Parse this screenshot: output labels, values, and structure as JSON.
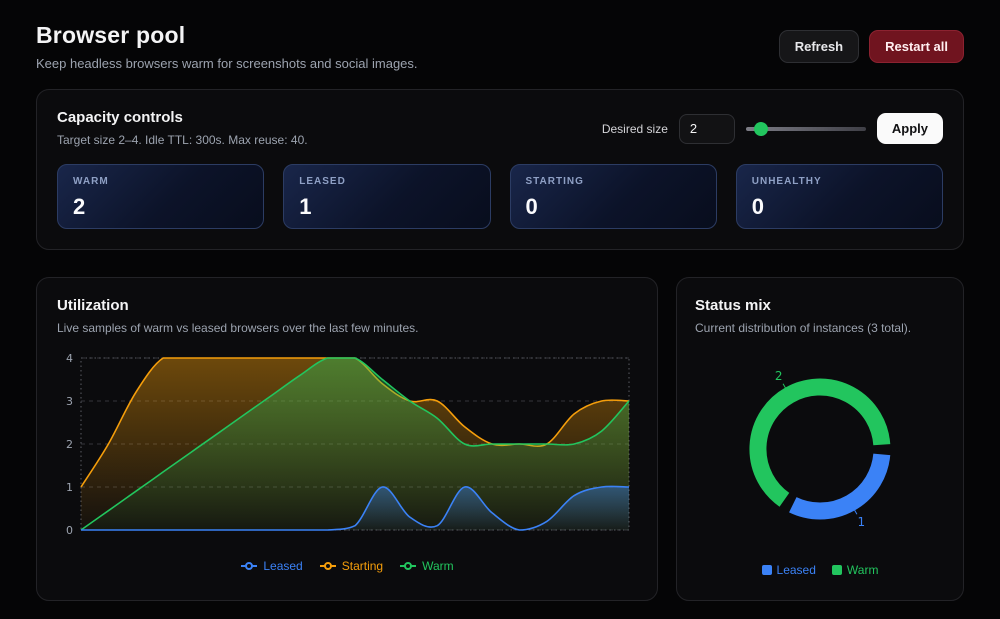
{
  "header": {
    "title": "Browser pool",
    "subtitle": "Keep headless browsers warm for screenshots and social images.",
    "buttons": {
      "refresh": "Refresh",
      "restart_all": "Restart all"
    }
  },
  "capacity": {
    "title": "Capacity controls",
    "subtitle": "Target size 2–4. Idle TTL: 300s. Max reuse: 40.",
    "desired_size": {
      "label": "Desired size",
      "value": "2"
    },
    "apply_label": "Apply",
    "slider_color": "#22c55e",
    "stats": [
      {
        "label": "WARM",
        "value": "2"
      },
      {
        "label": "LEASED",
        "value": "1"
      },
      {
        "label": "STARTING",
        "value": "0"
      },
      {
        "label": "UNHEALTHY",
        "value": "0"
      }
    ]
  },
  "utilization": {
    "title": "Utilization",
    "subtitle": "Live samples of warm vs leased browsers over the last few minutes.",
    "legend": [
      {
        "label": "Leased",
        "color": "#3b82f6"
      },
      {
        "label": "Starting",
        "color": "#f59e0b"
      },
      {
        "label": "Warm",
        "color": "#22c55e"
      }
    ]
  },
  "status_mix": {
    "title": "Status mix",
    "subtitle": "Current distribution of instances (3 total).",
    "legend": [
      {
        "label": "Leased",
        "color": "#3b82f6"
      },
      {
        "label": "Warm",
        "color": "#22c55e"
      }
    ]
  },
  "chart_data": [
    {
      "type": "area",
      "title": "Utilization",
      "x": [
        0,
        1,
        2,
        3,
        4,
        5,
        6,
        7,
        8,
        9,
        10,
        11,
        12,
        13,
        14,
        15,
        16,
        17,
        18,
        19,
        20
      ],
      "ylim": [
        0,
        4
      ],
      "yticks": [
        0,
        1,
        2,
        3,
        4
      ],
      "grid": true,
      "legend_position": "bottom",
      "series": [
        {
          "name": "Starting",
          "color": "#f59e0b",
          "values": [
            1,
            2,
            3.2,
            4,
            4,
            4,
            4,
            4,
            4,
            4,
            4,
            3.4,
            3,
            3,
            2.4,
            2,
            2,
            2,
            2.7,
            3,
            3
          ]
        },
        {
          "name": "Warm",
          "color": "#22c55e",
          "values": [
            0,
            0.45,
            0.9,
            1.35,
            1.8,
            2.25,
            2.7,
            3.15,
            3.6,
            4,
            4,
            3.5,
            3,
            2.6,
            2,
            2,
            2,
            2,
            2,
            2.3,
            3
          ]
        },
        {
          "name": "Leased",
          "color": "#3b82f6",
          "values": [
            0,
            0,
            0,
            0,
            0,
            0,
            0,
            0,
            0,
            0,
            0.1,
            1,
            0.3,
            0.1,
            1,
            0.4,
            0,
            0.2,
            0.8,
            1,
            1
          ]
        }
      ]
    },
    {
      "type": "pie",
      "title": "Status mix",
      "donut": true,
      "total": 3,
      "start_angle": 95,
      "gap_degrees": 9,
      "segments": [
        {
          "label": "Leased",
          "value": 1,
          "color": "#3b82f6"
        },
        {
          "label": "Warm",
          "value": 2,
          "color": "#22c55e"
        }
      ]
    }
  ]
}
